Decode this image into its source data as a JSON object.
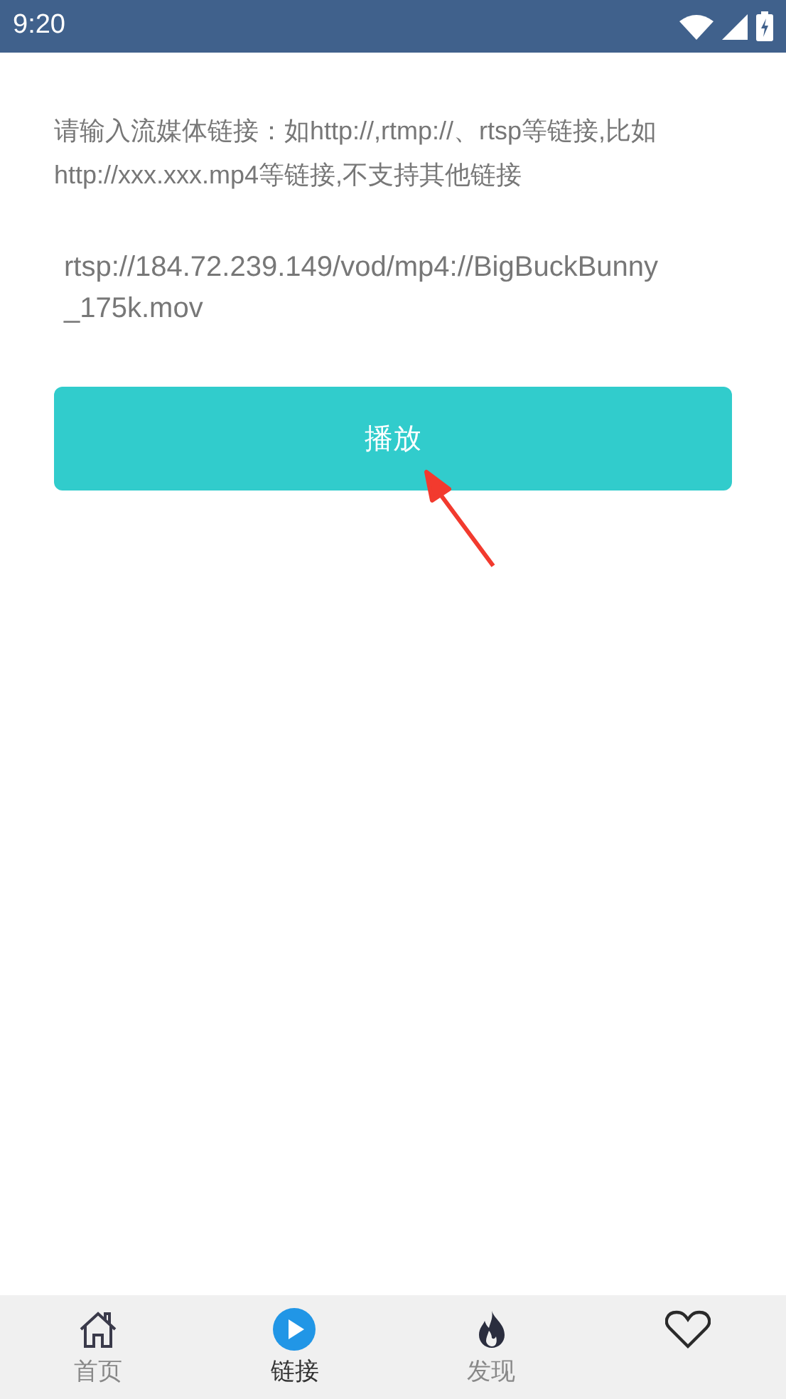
{
  "status_bar": {
    "time": "9:20"
  },
  "prompt": " 请输入流媒体链接：如http://,rtmp://、rtsp等链接,比如http://xxx.xxx.mp4等链接,不支持其他链接",
  "url_field": {
    "value": "rtsp://184.72.239.149/vod/mp4://BigBuckBunny_175k.mov"
  },
  "play_button": {
    "label": "播放"
  },
  "bottom_nav": [
    {
      "kind": "home",
      "label": "首页",
      "selected": false
    },
    {
      "kind": "play",
      "label": "链接",
      "selected": true
    },
    {
      "kind": "flame",
      "label": "发现",
      "selected": false
    },
    {
      "kind": "heart",
      "selected": false
    }
  ]
}
